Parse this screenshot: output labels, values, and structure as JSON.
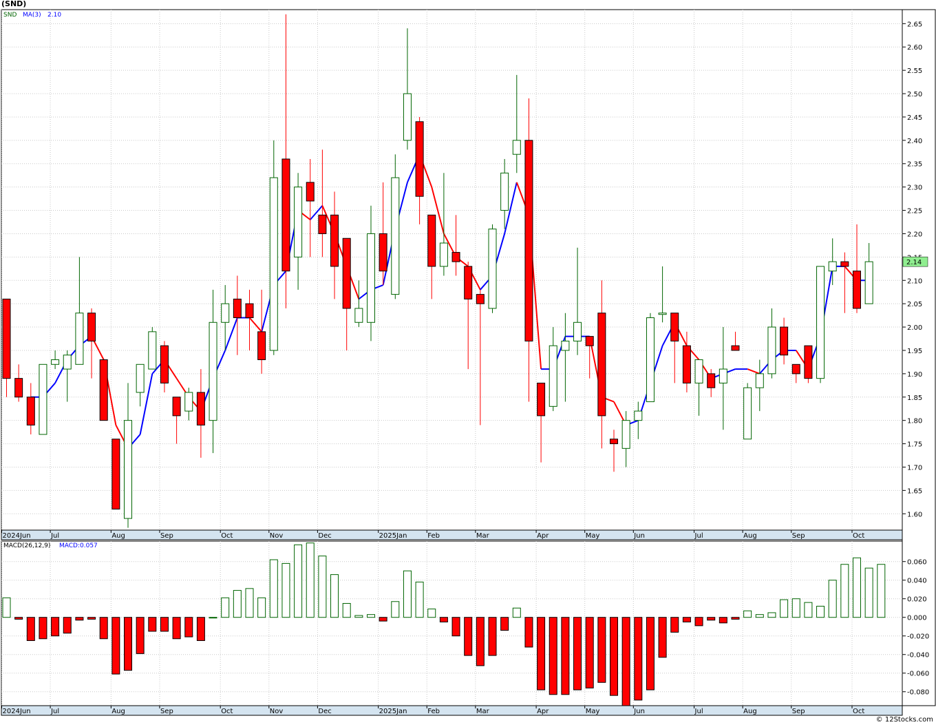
{
  "title": "(SND)",
  "credit": "© 12Stocks.com",
  "legend": {
    "symbol": "SND",
    "ma_label": "MA(3)",
    "ma_value": "2.10",
    "macd_label": "MACD(26,12,9)",
    "macd_value_label": "MACD:0.057"
  },
  "last_price_label": "2.14",
  "colors": {
    "up": "#006400",
    "down": "#ff0000",
    "ma_up": "#0000ff",
    "ma_down": "#ff0000",
    "grid": "#c8c8c8",
    "axis_strip": "#d4e4f0",
    "last_price_bg": "#90ee90"
  },
  "chart_data": [
    {
      "type": "candlestick",
      "ylim": [
        1.565,
        2.68
      ],
      "yticks": [
        "1.60",
        "1.65",
        "1.70",
        "1.75",
        "1.80",
        "1.85",
        "1.90",
        "1.95",
        "2.00",
        "2.05",
        "2.10",
        "2.15",
        "2.20",
        "2.25",
        "2.30",
        "2.35",
        "2.40",
        "2.45",
        "2.50",
        "2.55",
        "2.60",
        "2.65"
      ],
      "xticks": [
        {
          "label": "2024Jun",
          "index": 0
        },
        {
          "label": "Jul",
          "index": 4
        },
        {
          "label": "Aug",
          "index": 9
        },
        {
          "label": "Sep",
          "index": 13
        },
        {
          "label": "Oct",
          "index": 18
        },
        {
          "label": "Nov",
          "index": 22
        },
        {
          "label": "Dec",
          "index": 26
        },
        {
          "label": "2025Jan",
          "index": 31
        },
        {
          "label": "Feb",
          "index": 35
        },
        {
          "label": "Mar",
          "index": 39
        },
        {
          "label": "Apr",
          "index": 44
        },
        {
          "label": "May",
          "index": 48
        },
        {
          "label": "Jun",
          "index": 52
        },
        {
          "label": "Jul",
          "index": 57
        },
        {
          "label": "Aug",
          "index": 61
        },
        {
          "label": "Sep",
          "index": 65
        },
        {
          "label": "Oct",
          "index": 70
        }
      ],
      "candles": [
        {
          "o": 2.06,
          "h": 2.06,
          "l": 1.85,
          "c": 1.89
        },
        {
          "o": 1.89,
          "h": 1.92,
          "l": 1.84,
          "c": 1.85
        },
        {
          "o": 1.85,
          "h": 1.88,
          "l": 1.77,
          "c": 1.79
        },
        {
          "o": 1.77,
          "h": 1.92,
          "l": 1.77,
          "c": 1.92
        },
        {
          "o": 1.92,
          "h": 1.95,
          "l": 1.91,
          "c": 1.93
        },
        {
          "o": 1.91,
          "h": 1.95,
          "l": 1.84,
          "c": 1.94
        },
        {
          "o": 1.92,
          "h": 2.15,
          "l": 1.92,
          "c": 2.03
        },
        {
          "o": 2.03,
          "h": 2.04,
          "l": 1.89,
          "c": 1.97
        },
        {
          "o": 1.93,
          "h": 1.93,
          "l": 1.8,
          "c": 1.8
        },
        {
          "o": 1.76,
          "h": 1.76,
          "l": 1.61,
          "c": 1.61
        },
        {
          "o": 1.59,
          "h": 1.88,
          "l": 1.57,
          "c": 1.8
        },
        {
          "o": 1.86,
          "h": 1.92,
          "l": 1.83,
          "c": 1.92
        },
        {
          "o": 1.91,
          "h": 2.0,
          "l": 1.91,
          "c": 1.99
        },
        {
          "o": 1.96,
          "h": 1.97,
          "l": 1.86,
          "c": 1.88
        },
        {
          "o": 1.85,
          "h": 1.85,
          "l": 1.75,
          "c": 1.81
        },
        {
          "o": 1.82,
          "h": 1.87,
          "l": 1.8,
          "c": 1.86
        },
        {
          "o": 1.86,
          "h": 1.91,
          "l": 1.72,
          "c": 1.79
        },
        {
          "o": 1.8,
          "h": 2.08,
          "l": 1.73,
          "c": 2.01
        },
        {
          "o": 2.01,
          "h": 2.09,
          "l": 1.95,
          "c": 2.05
        },
        {
          "o": 2.06,
          "h": 2.11,
          "l": 1.94,
          "c": 2.02
        },
        {
          "o": 2.05,
          "h": 2.08,
          "l": 1.95,
          "c": 2.02
        },
        {
          "o": 1.99,
          "h": 2.08,
          "l": 1.9,
          "c": 1.93
        },
        {
          "o": 1.95,
          "h": 2.4,
          "l": 1.94,
          "c": 2.32
        },
        {
          "o": 2.36,
          "h": 2.67,
          "l": 2.04,
          "c": 2.12
        },
        {
          "o": 2.15,
          "h": 2.33,
          "l": 2.08,
          "c": 2.3
        },
        {
          "o": 2.31,
          "h": 2.36,
          "l": 2.15,
          "c": 2.27
        },
        {
          "o": 2.24,
          "h": 2.38,
          "l": 2.15,
          "c": 2.2
        },
        {
          "o": 2.24,
          "h": 2.29,
          "l": 2.06,
          "c": 2.13
        },
        {
          "o": 2.19,
          "h": 2.19,
          "l": 1.95,
          "c": 2.04
        },
        {
          "o": 2.01,
          "h": 2.1,
          "l": 2.0,
          "c": 2.04
        },
        {
          "o": 2.01,
          "h": 2.26,
          "l": 1.97,
          "c": 2.2
        },
        {
          "o": 2.2,
          "h": 2.31,
          "l": 2.09,
          "c": 2.12
        },
        {
          "o": 2.07,
          "h": 2.37,
          "l": 2.06,
          "c": 2.32
        },
        {
          "o": 2.4,
          "h": 2.64,
          "l": 2.38,
          "c": 2.5
        },
        {
          "o": 2.44,
          "h": 2.45,
          "l": 2.22,
          "c": 2.28
        },
        {
          "o": 2.24,
          "h": 2.24,
          "l": 2.06,
          "c": 2.13
        },
        {
          "o": 2.13,
          "h": 2.33,
          "l": 2.11,
          "c": 2.18
        },
        {
          "o": 2.16,
          "h": 2.24,
          "l": 2.11,
          "c": 2.14
        },
        {
          "o": 2.13,
          "h": 2.14,
          "l": 1.91,
          "c": 2.06
        },
        {
          "o": 2.07,
          "h": 2.08,
          "l": 1.79,
          "c": 2.05
        },
        {
          "o": 2.04,
          "h": 2.22,
          "l": 2.03,
          "c": 2.21
        },
        {
          "o": 2.25,
          "h": 2.36,
          "l": 2.21,
          "c": 2.33
        },
        {
          "o": 2.37,
          "h": 2.54,
          "l": 2.33,
          "c": 2.4
        },
        {
          "o": 2.4,
          "h": 2.49,
          "l": 1.84,
          "c": 1.97
        },
        {
          "o": 1.88,
          "h": 1.88,
          "l": 1.71,
          "c": 1.81
        },
        {
          "o": 1.83,
          "h": 2.0,
          "l": 1.82,
          "c": 1.96
        },
        {
          "o": 1.95,
          "h": 2.03,
          "l": 1.84,
          "c": 1.97
        },
        {
          "o": 1.97,
          "h": 2.17,
          "l": 1.94,
          "c": 2.01
        },
        {
          "o": 1.98,
          "h": 1.98,
          "l": 1.89,
          "c": 1.96
        },
        {
          "o": 2.03,
          "h": 2.1,
          "l": 1.74,
          "c": 1.81
        },
        {
          "o": 1.76,
          "h": 1.78,
          "l": 1.69,
          "c": 1.75
        },
        {
          "o": 1.74,
          "h": 1.82,
          "l": 1.7,
          "c": 1.8
        },
        {
          "o": 1.8,
          "h": 1.84,
          "l": 1.76,
          "c": 1.82
        },
        {
          "o": 1.84,
          "h": 2.03,
          "l": 1.84,
          "c": 2.02
        },
        {
          "o": 2.03,
          "h": 2.13,
          "l": 2.01,
          "c": 2.03
        },
        {
          "o": 2.03,
          "h": 2.03,
          "l": 1.88,
          "c": 1.97
        },
        {
          "o": 1.96,
          "h": 1.99,
          "l": 1.86,
          "c": 1.88
        },
        {
          "o": 1.88,
          "h": 1.93,
          "l": 1.81,
          "c": 1.93
        },
        {
          "o": 1.9,
          "h": 1.91,
          "l": 1.85,
          "c": 1.87
        },
        {
          "o": 1.88,
          "h": 2.0,
          "l": 1.78,
          "c": 1.91
        },
        {
          "o": 1.96,
          "h": 1.99,
          "l": 1.95,
          "c": 1.95
        },
        {
          "o": 1.76,
          "h": 1.88,
          "l": 1.76,
          "c": 1.87
        },
        {
          "o": 1.87,
          "h": 1.93,
          "l": 1.82,
          "c": 1.9
        },
        {
          "o": 1.9,
          "h": 2.04,
          "l": 1.89,
          "c": 2.0
        },
        {
          "o": 2.0,
          "h": 2.02,
          "l": 1.92,
          "c": 1.94
        },
        {
          "o": 1.92,
          "h": 1.92,
          "l": 1.88,
          "c": 1.9
        },
        {
          "o": 1.96,
          "h": 1.96,
          "l": 1.88,
          "c": 1.89
        },
        {
          "o": 1.89,
          "h": 2.13,
          "l": 1.88,
          "c": 2.13
        },
        {
          "o": 2.12,
          "h": 2.19,
          "l": 2.09,
          "c": 2.14
        },
        {
          "o": 2.14,
          "h": 2.16,
          "l": 2.03,
          "c": 2.13
        },
        {
          "o": 2.12,
          "h": 2.22,
          "l": 2.03,
          "c": 2.04
        },
        {
          "o": 2.05,
          "h": 2.18,
          "l": 2.05,
          "c": 2.14
        }
      ],
      "ma3": [
        null,
        null,
        1.85,
        1.85,
        1.88,
        1.93,
        1.96,
        1.98,
        1.93,
        1.79,
        1.74,
        1.77,
        1.9,
        1.93,
        1.89,
        1.85,
        1.82,
        1.89,
        1.95,
        2.02,
        2.02,
        1.99,
        2.09,
        2.12,
        2.25,
        2.23,
        2.26,
        2.2,
        2.13,
        2.06,
        2.08,
        2.09,
        2.21,
        2.31,
        2.37,
        2.3,
        2.2,
        2.15,
        2.13,
        2.08,
        2.11,
        2.2,
        2.31,
        2.24,
        1.91,
        1.91,
        1.98,
        1.98,
        1.98,
        1.85,
        1.84,
        1.79,
        1.8,
        1.88,
        1.96,
        2.01,
        1.96,
        1.93,
        1.89,
        1.9,
        1.91,
        1.91,
        1.9,
        1.93,
        1.95,
        1.95,
        1.91,
        1.98,
        2.13,
        2.13,
        2.1,
        2.1
      ]
    },
    {
      "type": "bar",
      "title": "MACD(26,12,9)",
      "ylim": [
        -0.095,
        0.082
      ],
      "yticks": [
        "-0.080",
        "-0.060",
        "-0.040",
        "-0.020",
        "0.000",
        "0.020",
        "0.040",
        "0.060"
      ],
      "values": [
        0.021,
        -0.002,
        -0.025,
        -0.023,
        -0.02,
        -0.017,
        -0.003,
        -0.002,
        -0.023,
        -0.061,
        -0.057,
        -0.039,
        -0.015,
        -0.015,
        -0.023,
        -0.021,
        -0.025,
        0.0,
        0.021,
        0.029,
        0.031,
        0.021,
        0.062,
        0.058,
        0.078,
        0.08,
        0.066,
        0.046,
        0.015,
        0.002,
        0.003,
        -0.004,
        0.017,
        0.05,
        0.038,
        0.009,
        -0.005,
        -0.02,
        -0.041,
        -0.052,
        -0.041,
        -0.014,
        0.01,
        -0.032,
        -0.078,
        -0.083,
        -0.083,
        -0.078,
        -0.076,
        -0.07,
        -0.084,
        -0.095,
        -0.089,
        -0.078,
        -0.043,
        -0.016,
        -0.005,
        -0.009,
        -0.003,
        -0.006,
        -0.002,
        0.007,
        0.003,
        0.005,
        0.019,
        0.02,
        0.016,
        0.012,
        0.04,
        0.057,
        0.064,
        0.053,
        0.057
      ]
    }
  ]
}
